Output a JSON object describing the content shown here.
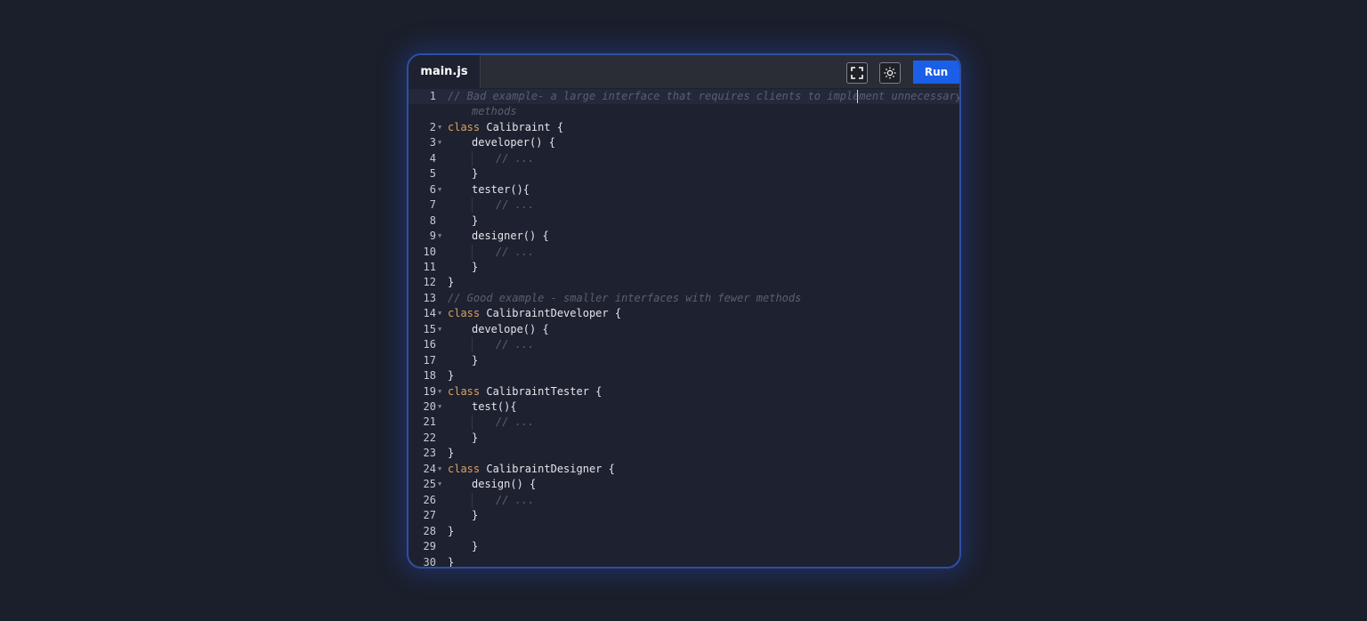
{
  "editor": {
    "tab_label": "main.js",
    "run_label": "Run",
    "fullscreen_icon": "fullscreen-icon",
    "theme_icon": "sun-icon",
    "colors": {
      "run": "#1b5fe8",
      "border": "#2f4fa3",
      "comment": "#5b6070",
      "keyword": "#d9a260"
    }
  },
  "lines": [
    {
      "num": "1",
      "fold": false,
      "indent": 0,
      "kw": "",
      "code": "",
      "comment": "// Bad example- a large interface that requires clients to implement unnecessary"
    },
    {
      "num": "",
      "fold": false,
      "indent": 1,
      "kw": "",
      "code": "",
      "comment": "methods"
    },
    {
      "num": "2",
      "fold": true,
      "indent": 0,
      "kw": "class",
      "code": " Calibraint {",
      "comment": ""
    },
    {
      "num": "3",
      "fold": true,
      "indent": 1,
      "kw": "",
      "code": "developer() {",
      "comment": ""
    },
    {
      "num": "4",
      "fold": false,
      "indent": 2,
      "kw": "",
      "code": "",
      "comment": "// ..."
    },
    {
      "num": "5",
      "fold": false,
      "indent": 1,
      "kw": "",
      "code": "}",
      "comment": ""
    },
    {
      "num": "6",
      "fold": true,
      "indent": 1,
      "kw": "",
      "code": "tester(){",
      "comment": ""
    },
    {
      "num": "7",
      "fold": false,
      "indent": 2,
      "kw": "",
      "code": "",
      "comment": "// ..."
    },
    {
      "num": "8",
      "fold": false,
      "indent": 1,
      "kw": "",
      "code": "}",
      "comment": ""
    },
    {
      "num": "9",
      "fold": true,
      "indent": 1,
      "kw": "",
      "code": "designer() {",
      "comment": ""
    },
    {
      "num": "10",
      "fold": false,
      "indent": 2,
      "kw": "",
      "code": "",
      "comment": "// ..."
    },
    {
      "num": "11",
      "fold": false,
      "indent": 1,
      "kw": "",
      "code": "}",
      "comment": ""
    },
    {
      "num": "12",
      "fold": false,
      "indent": 0,
      "kw": "",
      "code": "}",
      "comment": ""
    },
    {
      "num": "13",
      "fold": false,
      "indent": 0,
      "kw": "",
      "code": "",
      "comment": "// Good example - smaller interfaces with fewer methods"
    },
    {
      "num": "14",
      "fold": true,
      "indent": 0,
      "kw": "class",
      "code": " CalibraintDeveloper {",
      "comment": ""
    },
    {
      "num": "15",
      "fold": true,
      "indent": 1,
      "kw": "",
      "code": "develope() {",
      "comment": ""
    },
    {
      "num": "16",
      "fold": false,
      "indent": 2,
      "kw": "",
      "code": "",
      "comment": "// ..."
    },
    {
      "num": "17",
      "fold": false,
      "indent": 1,
      "kw": "",
      "code": "}",
      "comment": ""
    },
    {
      "num": "18",
      "fold": false,
      "indent": 0,
      "kw": "",
      "code": "}",
      "comment": ""
    },
    {
      "num": "19",
      "fold": true,
      "indent": 0,
      "kw": "class",
      "code": " CalibraintTester {",
      "comment": ""
    },
    {
      "num": "20",
      "fold": true,
      "indent": 1,
      "kw": "",
      "code": "test(){",
      "comment": ""
    },
    {
      "num": "21",
      "fold": false,
      "indent": 2,
      "kw": "",
      "code": "",
      "comment": "// ..."
    },
    {
      "num": "22",
      "fold": false,
      "indent": 1,
      "kw": "",
      "code": "}",
      "comment": ""
    },
    {
      "num": "23",
      "fold": false,
      "indent": 0,
      "kw": "",
      "code": "}",
      "comment": ""
    },
    {
      "num": "24",
      "fold": true,
      "indent": 0,
      "kw": "class",
      "code": " CalibraintDesigner {",
      "comment": ""
    },
    {
      "num": "25",
      "fold": true,
      "indent": 1,
      "kw": "",
      "code": "design() {",
      "comment": ""
    },
    {
      "num": "26",
      "fold": false,
      "indent": 2,
      "kw": "",
      "code": "",
      "comment": "// ..."
    },
    {
      "num": "27",
      "fold": false,
      "indent": 1,
      "kw": "",
      "code": "}",
      "comment": ""
    },
    {
      "num": "28",
      "fold": false,
      "indent": 0,
      "kw": "",
      "code": "}",
      "comment": ""
    },
    {
      "num": "29",
      "fold": false,
      "indent": 1,
      "kw": "",
      "code": "}",
      "comment": ""
    },
    {
      "num": "30",
      "fold": false,
      "indent": 0,
      "kw": "",
      "code": "}",
      "comment": ""
    }
  ]
}
